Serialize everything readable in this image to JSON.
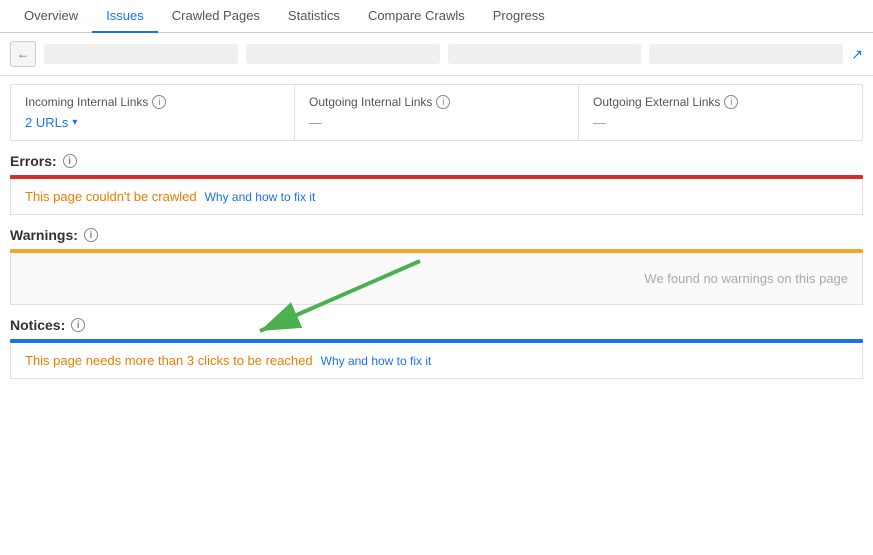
{
  "nav": {
    "tabs": [
      {
        "label": "Overview",
        "active": false
      },
      {
        "label": "Issues",
        "active": true
      },
      {
        "label": "Crawled Pages",
        "active": false
      },
      {
        "label": "Statistics",
        "active": false
      },
      {
        "label": "Compare Crawls",
        "active": false
      },
      {
        "label": "Progress",
        "active": false
      }
    ]
  },
  "url_bar": {
    "back_label": "←",
    "external_icon": "↗"
  },
  "links": {
    "incoming": {
      "title": "Incoming Internal Links",
      "value": "2 URLs",
      "has_dropdown": true
    },
    "outgoing_internal": {
      "title": "Outgoing Internal Links",
      "value": "—"
    },
    "outgoing_external": {
      "title": "Outgoing External Links",
      "value": "—"
    }
  },
  "errors_section": {
    "title": "Errors:",
    "issue": {
      "text": "This page couldn't be crawled",
      "fix_text": "Why and how to fix it"
    }
  },
  "warnings_section": {
    "title": "Warnings:",
    "empty_text": "We found no warnings on this page"
  },
  "notices_section": {
    "title": "Notices:",
    "issue": {
      "text": "This page needs more than 3 clicks to be reached",
      "fix_text": "Why and how to fix it"
    }
  },
  "info_icon_label": "i",
  "chevron": "▾",
  "colors": {
    "red": "#d32f2f",
    "orange": "#f5a623",
    "blue": "#1a73e8"
  }
}
